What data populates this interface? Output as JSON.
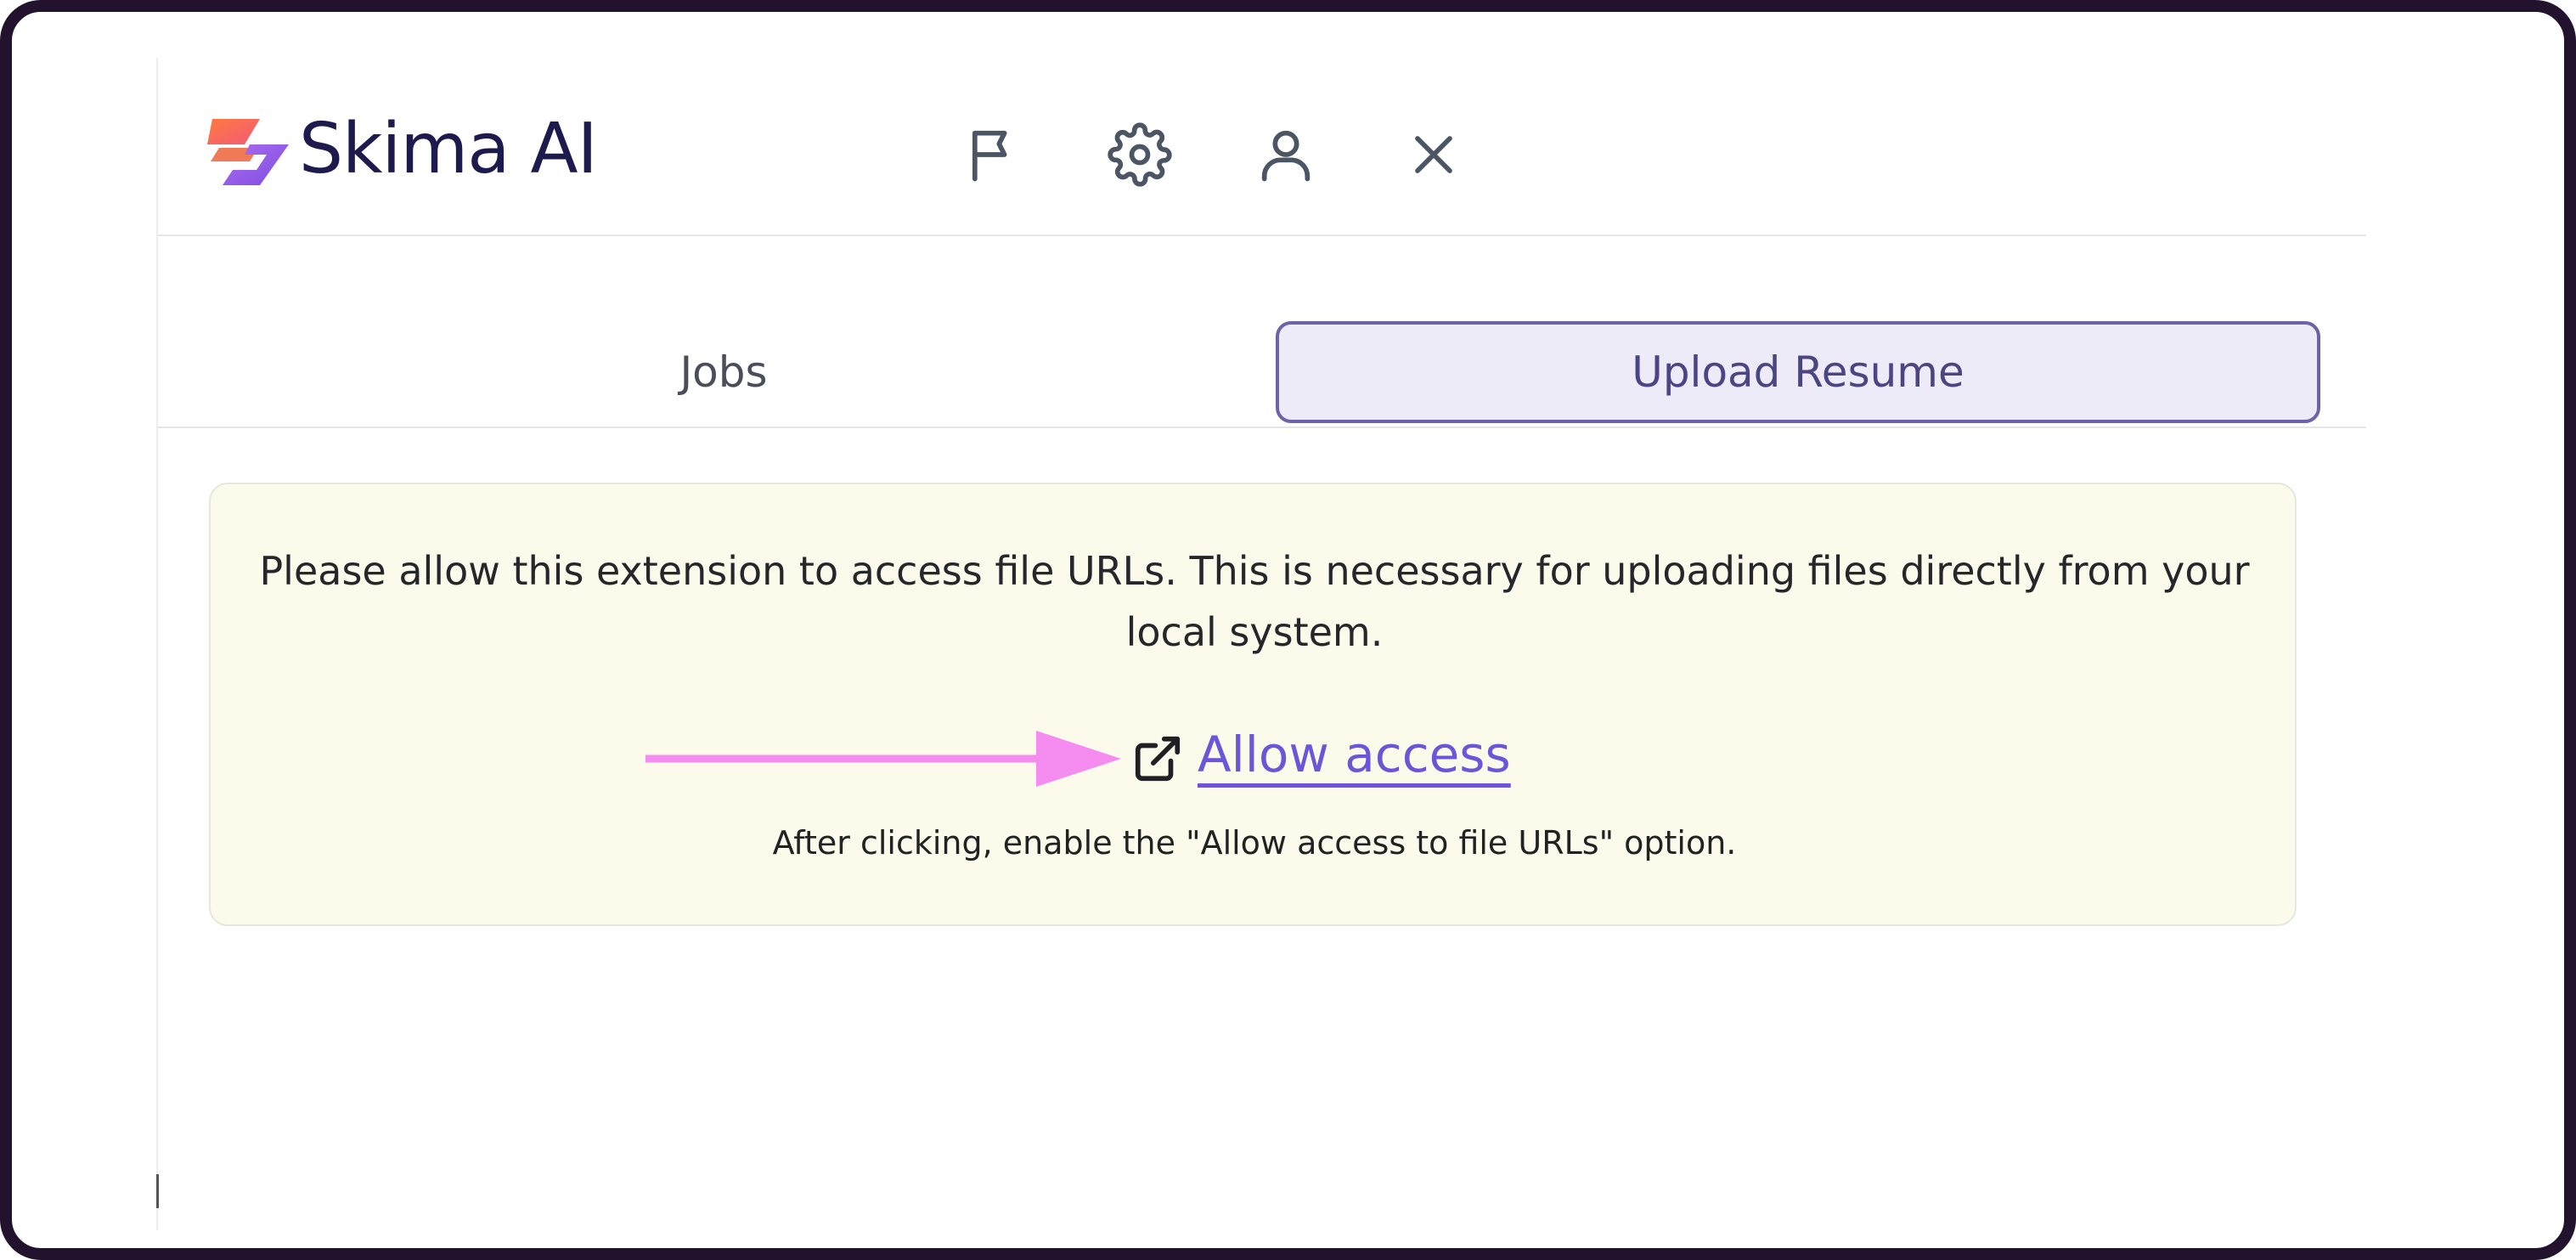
{
  "header": {
    "brand_name": "Skima AI",
    "icons": [
      "flag-icon",
      "gear-icon",
      "user-icon",
      "close-icon"
    ]
  },
  "tabs": [
    {
      "label": "Jobs",
      "active": false
    },
    {
      "label": "Upload Resume",
      "active": true
    }
  ],
  "notice": {
    "message": "Please allow this extension to access file URLs. This is necessary for uploading files directly from your local system.",
    "link_label": "Allow access",
    "hint": "After clicking, enable the \"Allow access to file URLs\" option."
  },
  "colors": {
    "brand_text": "#1d1a4d",
    "active_tab_bg": "#eeebf9",
    "active_tab_border": "#6f62a8",
    "notice_bg": "#fcfaea",
    "link": "#6b55d9",
    "arrow": "#f58cf0",
    "frame": "#22122e"
  }
}
